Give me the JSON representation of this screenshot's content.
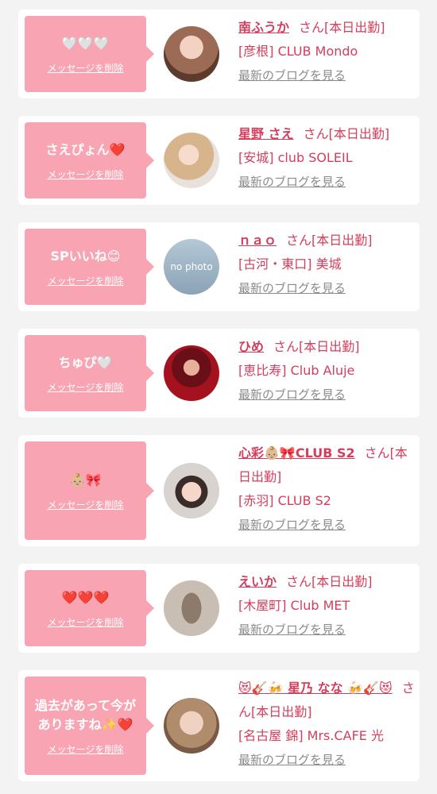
{
  "delete_label": "メッセージを削除",
  "blog_label": "最新のブログを見る",
  "cards": [
    {
      "message": "🤍🤍🤍",
      "name": "南ふうか",
      "suffix": "さん[本日出勤]",
      "shop": "[彦根] CLUB Mondo"
    },
    {
      "message": "さえぴょん❤️",
      "name": "星野 さえ",
      "suffix": "さん[本日出勤]",
      "shop": "[安城] club SOLEIL"
    },
    {
      "message": "SPいいね😊",
      "name": "ｎａｏ",
      "suffix": "さん[本日出勤]",
      "shop": "[古河・東口] 美城",
      "avatar_text": "no photo"
    },
    {
      "message": "ちゅぴ🤍",
      "name": "ひめ",
      "suffix": "さん[本日出勤]",
      "shop": "[恵比寿] Club Aluje"
    },
    {
      "message": "👶🏼🎀",
      "name": "心彩👶🏼🎀CLUB S2",
      "suffix": "さん[本日出勤]",
      "shop": "[赤羽] CLUB S2"
    },
    {
      "message": "❤️❤️❤️",
      "name": "えいか",
      "suffix": "さん[本日出勤]",
      "shop": "[木屋町] Club MET"
    },
    {
      "message": "過去があって今がありますね✨❤️",
      "name": "😻🎸🍻 星乃 なな 🍻🎸😻",
      "suffix": "さん[本日出勤]",
      "shop": "[名古屋 錦] Mrs.CAFE 光"
    }
  ]
}
